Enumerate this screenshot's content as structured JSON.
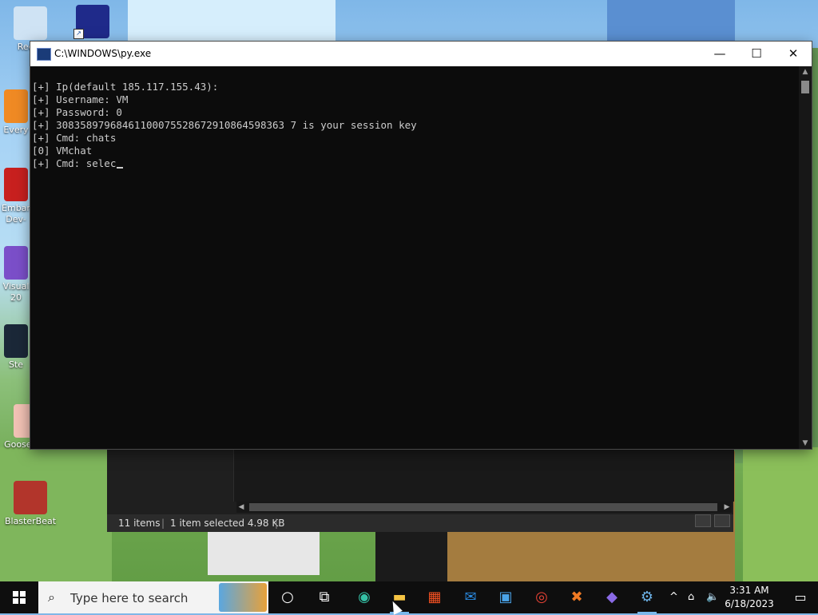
{
  "desktop": {
    "icons": [
      {
        "label": "Recyc",
        "color": "#cfe3f4"
      },
      {
        "label": "Every",
        "color": "#f08a24"
      },
      {
        "label": "Embar Dev-",
        "color": "#c8201f"
      },
      {
        "label": "Visual 20",
        "color": "#7b4fc9"
      },
      {
        "label": "Ste",
        "color": "#1b2838"
      },
      {
        "label": "Goose Duck",
        "color": "#f2c2b5"
      },
      {
        "label": "BlasterBeat",
        "color": "#b2352b"
      }
    ],
    "top_icon_color": "#1f2a8a"
  },
  "console": {
    "title": "C:\\WINDOWS\\py.exe",
    "lines": [
      "[+] Ip(default 185.117.155.43):",
      "[+] Username: VM",
      "[+] Password: 0",
      "[+] 30835897968461100075528672910864598363 7 is your session key",
      "[+] Cmd: chats",
      "[0] VMchat",
      "[+] Cmd: selec"
    ],
    "minimize": "—",
    "maximize": "☐",
    "close": "✕"
  },
  "explorer": {
    "item_count": "11 items",
    "selection": "1 item selected  4.98 KB"
  },
  "taskbar": {
    "search_placeholder": "Type here to search",
    "time": "3:31 AM",
    "date": "6/18/2023"
  }
}
